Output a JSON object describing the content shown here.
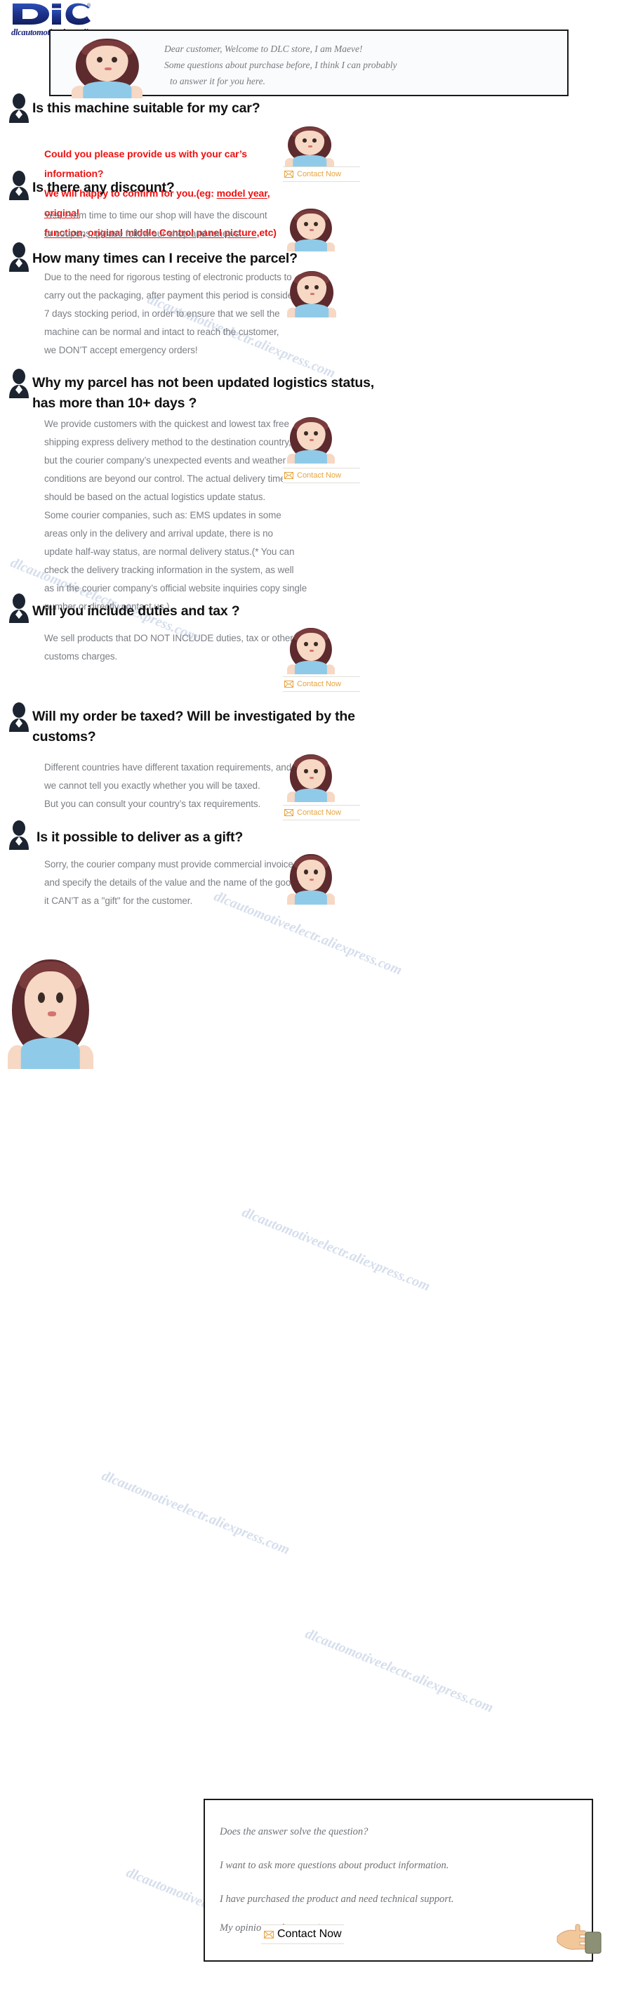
{
  "brand": {
    "logo_text": "DlC",
    "store_url": "dlcautomotiveelectr.aliexpress.com",
    "watermark": "dlcautomotiveelectr.aliexpress.com",
    "accent_color": "#e8a43c",
    "logo_color": "#1f3a93",
    "question_color": "#111111",
    "answer_color": "#7b7f85",
    "alert_color": "#ee1111"
  },
  "intro": {
    "line1": "Dear customer, Welcome to DLC store, I am Maeve!",
    "line2": "Some questions about purchase before, I think I can probably",
    "line3": "to answer it for you here."
  },
  "contact": {
    "label": "Contact Now",
    "icon": "envelope-icon"
  },
  "faq": [
    {
      "id": "q1",
      "question": "Is this machine suitable for my car?",
      "answer_lines": [
        "Could you please provide us with your car’s information?",
        "We will happy to confirm for you.(eg: model year, original",
        "function, original middle Control panel picture,etc)"
      ],
      "highlight": "red",
      "avatar": "girl-worried-hands-on-cheeks",
      "has_contact": true
    },
    {
      "id": "q2",
      "question": "Is there any discount?",
      "answer_lines": [
        "Yes, From time to time our shop will have the discount",
        "or coupons, please follow our shop and renews."
      ],
      "highlight": "none",
      "avatar": "girl-thinking-finger-on-chin",
      "has_contact": false
    },
    {
      "id": "q3",
      "question": "How many times can I receive the parcel?",
      "answer_lines": [
        "Due to the need for rigorous testing of electronic products to",
        "carry out the packaging, after payment this period is considered",
        "7 days stocking period, in order to ensure that we sell the",
        "machine can be normal and intact to reach the customer,",
        "we DON’T accept emergency orders!"
      ],
      "highlight": "none",
      "avatar": "girl-covering-ears",
      "has_contact": false
    },
    {
      "id": "q4",
      "question_lines": [
        "Why my parcel has not been updated logistics status,",
        "has more than 10+ days ?"
      ],
      "question": "Why my parcel has not been updated logistics status, has more than 10+ days ?",
      "answer_lines": [
        "We provide customers with the quickest and lowest tax free",
        "shipping express delivery method to the destination country,",
        "but the courier company’s unexpected events and weather",
        "conditions are beyond our control. The actual delivery time",
        "should be based on the actual logistics update status.",
        "Some courier companies, such as: EMS updates in some",
        "areas only in the delivery and arrival update, there is no",
        "update half-way status, are normal delivery status.(* You can",
        " check the delivery tracking information in the system, as well",
        "as in the courier company’s official website inquiries copy single",
        " number or directly contact us.)"
      ],
      "highlight": "none",
      "avatar": "girl-shocked-mouth-open",
      "has_contact": true
    },
    {
      "id": "q5",
      "question": "Will you include duties and tax ?",
      "answer_lines": [
        "We sell products that DO NOT INCLUDE duties, tax or other",
        "customs charges."
      ],
      "highlight": "none",
      "avatar": "girl-looking-up",
      "has_contact": true
    },
    {
      "id": "q6",
      "question_lines": [
        "Will my order be taxed? Will be investigated by the",
        "customs?"
      ],
      "question": "Will my order be taxed? Will be investigated by the customs?",
      "answer_lines": [
        "Different countries have different taxation requirements, and",
        "we cannot tell you exactly whether you will be taxed.",
        "But you can consult your country’s tax requirements."
      ],
      "highlight": "none",
      "avatar": "girl-peace-signs",
      "has_contact": true
    },
    {
      "id": "q7",
      "question": "Is it possible to deliver as a gift?",
      "answer_lines": [
        "Sorry, the courier company must provide commercial invoice",
        "and specify the details of the value and the name of the goods,",
        "it CAN’T as a \"gift\" for the customer."
      ],
      "highlight": "none",
      "avatar": "girl-sad-pouting",
      "has_contact": false
    }
  ],
  "footer": {
    "lines": [
      "Does the answer solve the question?",
      "I want to ask more questions about product information.",
      "I have purchased the product and need technical support.",
      "My opinion and suggestion."
    ],
    "avatar": "girl-winking-thumbs-up",
    "pointer": "pointing-hand-icon"
  }
}
